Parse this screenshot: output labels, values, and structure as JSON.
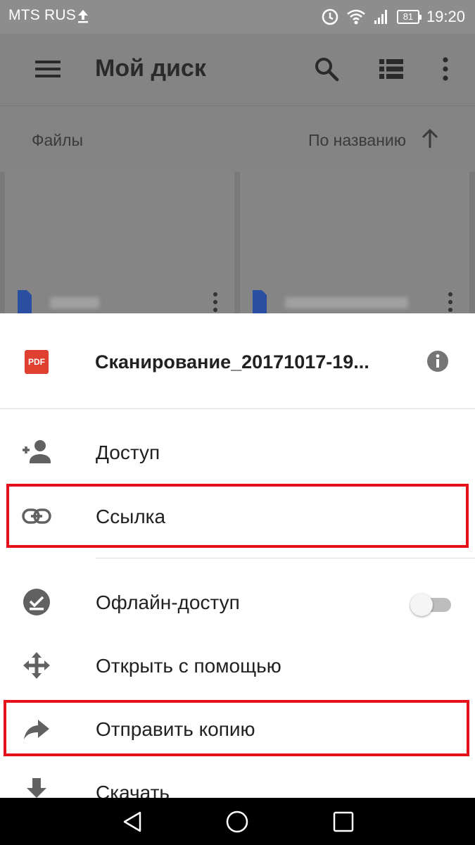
{
  "status_bar": {
    "carrier": "MTS RUS",
    "battery": "81",
    "time": "19:20"
  },
  "app_bar": {
    "title": "Мой диск",
    "icons": [
      "menu-icon",
      "search-icon",
      "list-view-icon",
      "more-vert-icon"
    ]
  },
  "sort_bar": {
    "section_label": "Файлы",
    "sort_label": "По названию",
    "sort_direction_icon": "arrow-up-icon"
  },
  "file": {
    "type_badge": "PDF",
    "name": "Сканирование_20171017-19..."
  },
  "menu": {
    "access": "Доступ",
    "link": "Ссылка",
    "offline": "Офлайн-доступ",
    "open_with": "Открыть с помощью",
    "send_copy": "Отправить копию",
    "download": "Скачать"
  },
  "offline_toggle": {
    "enabled": false
  },
  "colors": {
    "highlight": "#e5101c",
    "pdf_badge": "#e04030",
    "doc_icon": "#2b4fa0",
    "scrim": "#848484"
  }
}
